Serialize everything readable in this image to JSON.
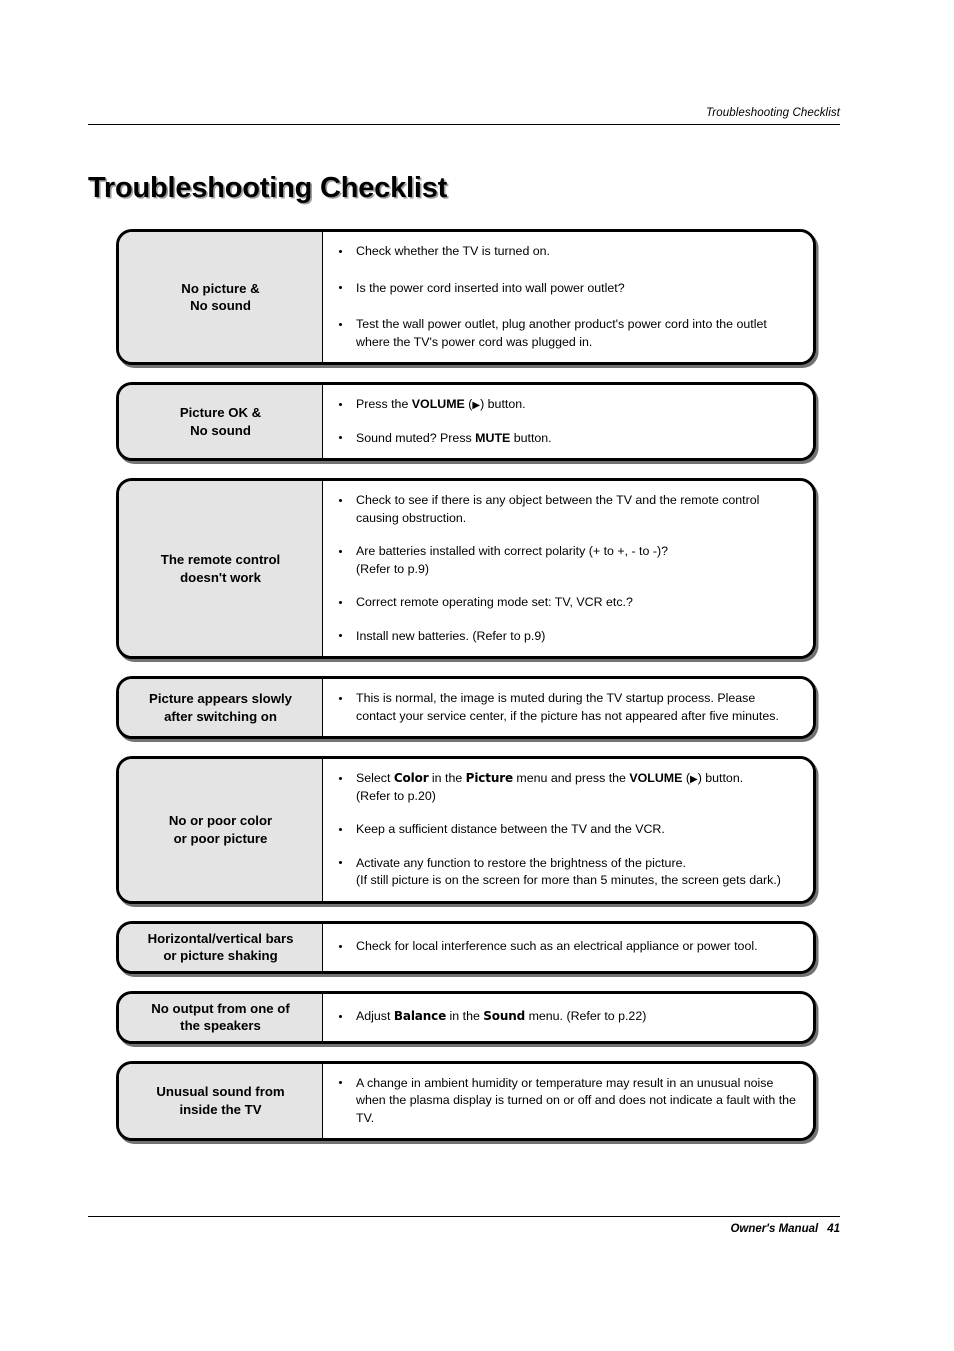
{
  "header": {
    "running_head": "Troubleshooting Checklist"
  },
  "title": "Troubleshooting Checklist",
  "footer": {
    "manual_label": "Owner's Manual",
    "page_number": "41"
  },
  "colors": {
    "label_cell_bg": "#e4e4e4",
    "border": "#000000",
    "page_bg": "#ffffff"
  },
  "checklist": {
    "rows": [
      {
        "label_line1": "No picture &",
        "label_line2": "No sound",
        "spacing": "lg",
        "items": [
          {
            "parts": [
              {
                "t": "Check whether the TV is turned on.",
                "s": "n"
              }
            ]
          },
          {
            "parts": [
              {
                "t": "Is the power cord inserted into wall power outlet?",
                "s": "n"
              }
            ]
          },
          {
            "parts": [
              {
                "t": "Test the wall power outlet, plug another product's power cord into the outlet where the TV's power cord was plugged in.",
                "s": "n"
              }
            ]
          }
        ]
      },
      {
        "label_line1": "Picture OK &",
        "label_line2": "No sound",
        "spacing": "md",
        "items": [
          {
            "parts": [
              {
                "t": "Press the ",
                "s": "n"
              },
              {
                "t": "VOLUME",
                "s": "b"
              },
              {
                "t": " (",
                "s": "n"
              },
              {
                "t": "▶",
                "s": "tri"
              },
              {
                "t": ") button.",
                "s": "n"
              }
            ]
          },
          {
            "parts": [
              {
                "t": "Sound muted? Press ",
                "s": "n"
              },
              {
                "t": "MUTE",
                "s": "b"
              },
              {
                "t": " button.",
                "s": "n"
              }
            ]
          }
        ]
      },
      {
        "label_line1": "The remote control",
        "label_line2": "doesn't work",
        "spacing": "md",
        "items": [
          {
            "parts": [
              {
                "t": "Check to see if there is any object between the TV and the remote control causing obstruction.",
                "s": "n"
              }
            ]
          },
          {
            "parts": [
              {
                "t": "Are batteries installed with correct polarity (+ to +, - to -)?",
                "s": "n"
              }
            ],
            "sub": "(Refer to p.9)"
          },
          {
            "parts": [
              {
                "t": "Correct remote operating mode set: TV, VCR etc.?",
                "s": "n"
              }
            ]
          },
          {
            "parts": [
              {
                "t": "Install new batteries. (Refer to p.9)",
                "s": "n"
              }
            ]
          }
        ]
      },
      {
        "label_line1": "Picture appears slowly",
        "label_line2": "after switching on",
        "spacing": "sm",
        "items": [
          {
            "parts": [
              {
                "t": "This is normal, the image is muted during the TV startup process. Please contact your service center, if the picture has not appeared after five minutes.",
                "s": "n"
              }
            ]
          }
        ]
      },
      {
        "label_line1": "No or poor color",
        "label_line2": "or poor picture",
        "spacing": "md",
        "items": [
          {
            "parts": [
              {
                "t": "Select ",
                "s": "n"
              },
              {
                "t": "Color",
                "s": "bs"
              },
              {
                "t": " in the ",
                "s": "n"
              },
              {
                "t": "Picture",
                "s": "bs"
              },
              {
                "t": " menu and press the ",
                "s": "n"
              },
              {
                "t": "VOLUME",
                "s": "b"
              },
              {
                "t": " (",
                "s": "n"
              },
              {
                "t": "▶",
                "s": "tri"
              },
              {
                "t": ") button.",
                "s": "n"
              }
            ],
            "sub": "(Refer to p.20)"
          },
          {
            "parts": [
              {
                "t": "Keep a sufficient distance between the TV and the VCR.",
                "s": "n"
              }
            ]
          },
          {
            "parts": [
              {
                "t": "Activate any function to restore the brightness of the picture.",
                "s": "n"
              }
            ],
            "sub": "(If still picture is on the screen for more than 5 minutes, the screen gets dark.)"
          }
        ]
      },
      {
        "label_line1": "Horizontal/vertical bars",
        "label_line2": "or picture shaking",
        "spacing": "sm",
        "items": [
          {
            "parts": [
              {
                "t": "Check for local interference such as an electrical appliance or power tool.",
                "s": "n"
              }
            ]
          }
        ]
      },
      {
        "label_line1": "No output from one of",
        "label_line2": "the speakers",
        "spacing": "sm",
        "items": [
          {
            "parts": [
              {
                "t": "Adjust ",
                "s": "n"
              },
              {
                "t": "Balance",
                "s": "bs"
              },
              {
                "t": " in the ",
                "s": "n"
              },
              {
                "t": "Sound",
                "s": "bs"
              },
              {
                "t": " menu. (Refer to p.22)",
                "s": "n"
              }
            ]
          }
        ]
      },
      {
        "label_line1": "Unusual sound from",
        "label_line2": "inside the TV",
        "spacing": "sm",
        "items": [
          {
            "parts": [
              {
                "t": "A change in ambient humidity or temperature may result in an unusual noise when the plasma display is turned on or off and does not indicate a fault with the TV.",
                "s": "n"
              }
            ]
          }
        ]
      }
    ]
  }
}
